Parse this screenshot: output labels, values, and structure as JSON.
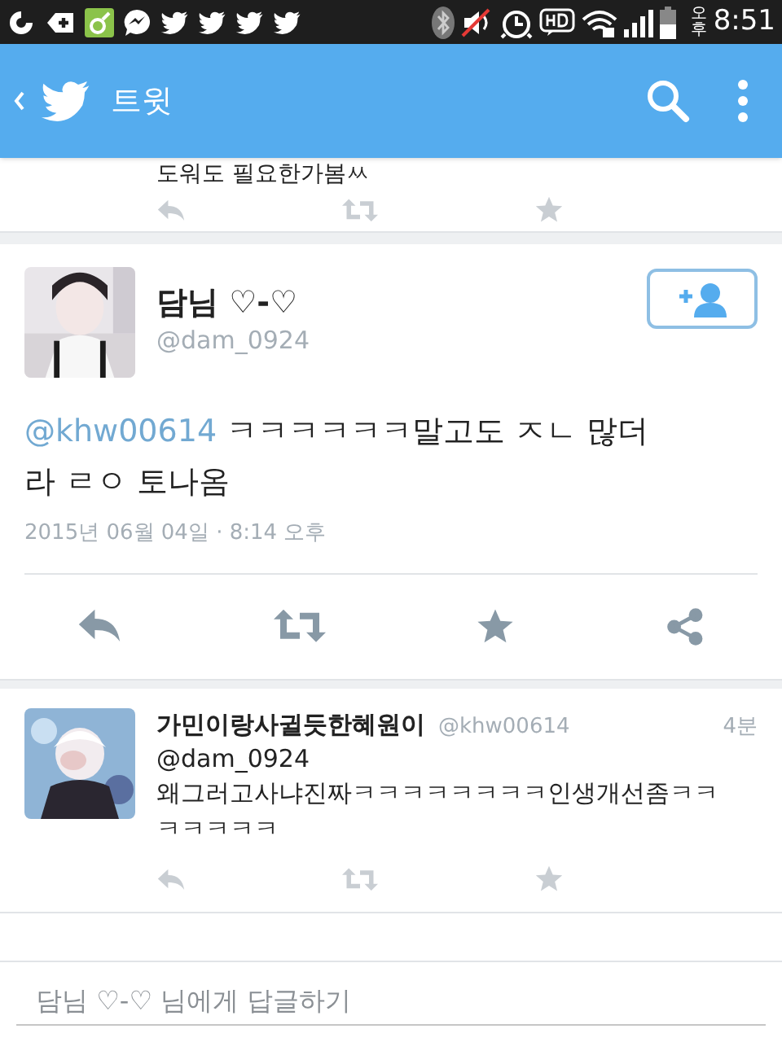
{
  "status_bar": {
    "time_period": "오후",
    "time": "8:51"
  },
  "header": {
    "title": "트윗"
  },
  "previous_tweet": {
    "text_fragment": "도워도 필요한가봄ㅆ"
  },
  "tweet": {
    "name": "담님 ♡-♡",
    "handle": "@dam_0924",
    "mention": "@khw00614",
    "text": "ㅋㅋㅋㅋㅋㅋ말고도 ㅈㄴ 많더라 ㄹㅇ 토나옴",
    "timestamp": "2015년 06월 04일 · 8:14 오후"
  },
  "replies": [
    {
      "name": "가민이랑사귈듯한혜원이",
      "handle": "@khw00614",
      "age": "4분",
      "reply_to": "@dam_0924",
      "text": "왜그러고사냐진짜ㅋㅋㅋㅋㅋㅋㅋㅋ인생개선좀ㅋㅋㅋㅋㅋㅋㅋ"
    }
  ],
  "reply_field": {
    "placeholder": "담님 ♡-♡ 님에게 답글하기"
  }
}
